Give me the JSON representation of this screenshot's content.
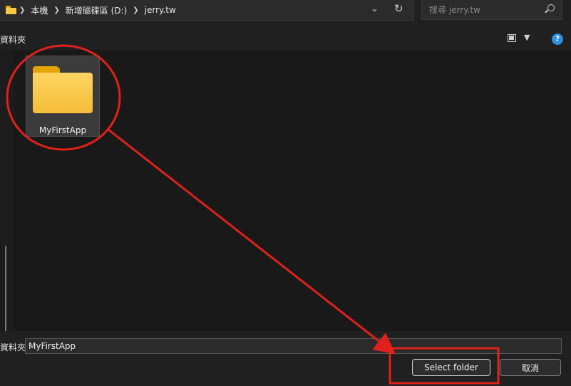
{
  "address_bar": {
    "breadcrumbs": [
      "本機",
      "新增磁碟區 (D:)",
      "jerry.tw"
    ]
  },
  "search": {
    "placeholder": "搜尋 jerry.tw"
  },
  "toolbar": {
    "nav_pane_label": "資料夾"
  },
  "content": {
    "items": [
      {
        "name": "MyFirstApp",
        "type": "folder",
        "selected": true
      }
    ]
  },
  "bottom": {
    "filename_label": "資料夾:",
    "filename_value": "MyFirstApp",
    "select_button_label": "Select folder",
    "cancel_button_label": "取消"
  },
  "colors": {
    "background": "#191919",
    "folder_yellow": "#f6c843",
    "annotation_red": "#e0201b",
    "help_blue": "#2f8ee0"
  }
}
